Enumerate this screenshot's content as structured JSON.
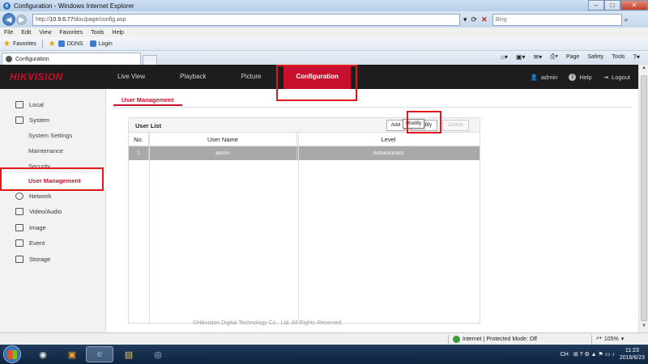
{
  "browser": {
    "window_title": "Configuration - Windows Internet Explorer",
    "url_prefix": "http://",
    "url_host": "10.9.6.77",
    "url_path": "/doc/page/config.asp",
    "search_placeholder": "Bing",
    "menu": [
      "File",
      "Edit",
      "View",
      "Favorites",
      "Tools",
      "Help"
    ],
    "favorites_label": "Favorites",
    "favorite_links": [
      "DDNS",
      "Login"
    ],
    "tab_title": "Configuration",
    "command_bar": [
      "Page",
      "Safety",
      "Tools"
    ]
  },
  "app": {
    "logo": "HIKVISION",
    "nav": [
      "Live View",
      "Playback",
      "Picture",
      "Configuration"
    ],
    "active_nav": "Configuration",
    "user_label": "admin",
    "help_label": "Help",
    "logout_label": "Logout"
  },
  "sidebar": {
    "local": "Local",
    "system": "System",
    "system_settings": "System Settings",
    "maintenance": "Maintenance",
    "security": "Security",
    "user_management": "User Management",
    "network": "Network",
    "video_audio": "Video/Audio",
    "image": "Image",
    "event": "Event",
    "storage": "Storage"
  },
  "content": {
    "tab_label": "User Management",
    "panel_title": "User List",
    "add_label": "Add",
    "modify_label": "Modify",
    "delete_label": "Delete",
    "tooltip": "Modify",
    "columns": [
      "No.",
      "User Name",
      "Level"
    ],
    "rows": [
      {
        "no": "1",
        "name": "admin",
        "level": "Administrator"
      }
    ],
    "copyright": "©Hikvision Digital Technology Co., Ltd. All Rights Reserved."
  },
  "statusbar": {
    "zone": "Internet | Protected Mode: Off",
    "zoom": "105%"
  },
  "taskbar": {
    "lang": "CH",
    "time": "11:23",
    "date": "2016/6/23"
  },
  "colors": {
    "brand_red": "#c8102e",
    "highlight_red": "#e01a1a",
    "header_bg": "#1d1d1d"
  }
}
